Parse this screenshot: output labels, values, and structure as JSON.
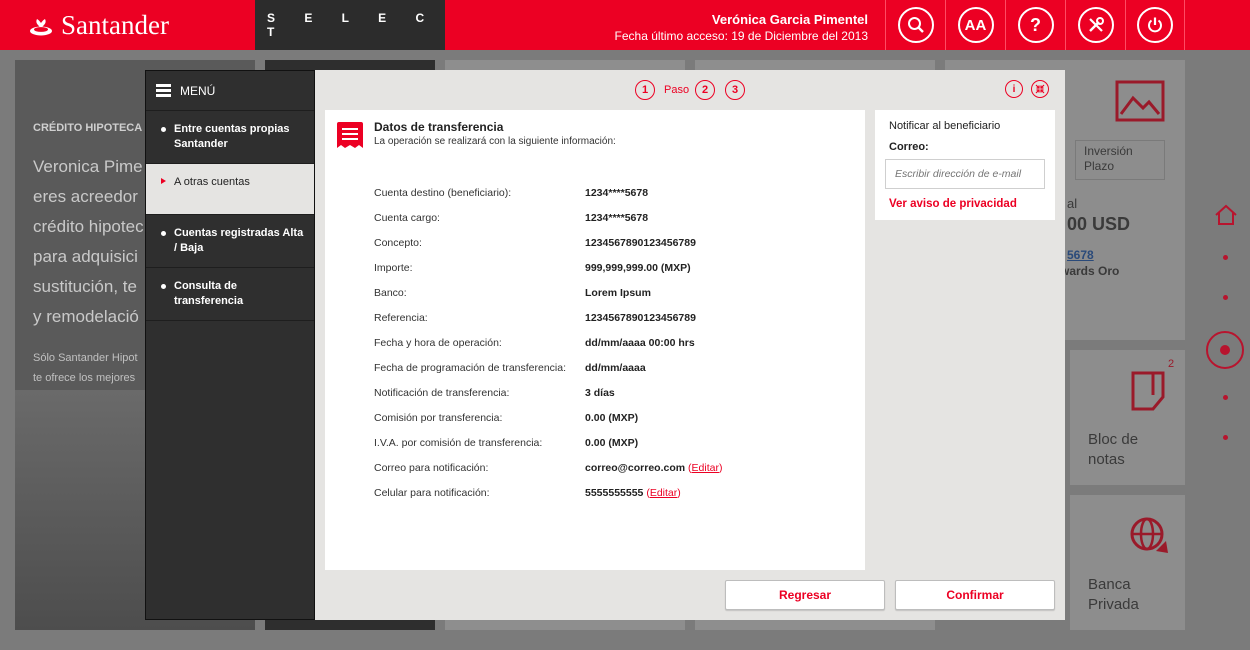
{
  "header": {
    "brand": "Santander",
    "segment": "S E L E C T",
    "user_name": "Verónica Garcia Pimentel",
    "last_access": "Fecha último acceso: 19 de Diciembre del 2013",
    "font_size_label": "AA",
    "help_label": "?"
  },
  "background": {
    "hero_kicker": "CRÉDITO HIPOTECA",
    "hero_lines": [
      "Veronica Pime",
      "eres acreedor",
      "crédito hipotec",
      "para adquisici",
      "sustitución, te",
      "y remodelació"
    ],
    "hero_small": [
      "Sólo Santander Hipot",
      "te ofrece los mejores"
    ],
    "inv_label": "Inversión Plazo",
    "amount_fragment": "00 USD",
    "account_fragment": "5678",
    "card_fragment": "wards Oro",
    "al_fragment": "al",
    "notes_badge": "2",
    "notes_label": "Bloc de notas",
    "bank_label": "Banca Privada"
  },
  "menu": {
    "title": "MENÚ",
    "items": [
      {
        "label": "Entre cuentas propias Santander"
      },
      {
        "label": "A otras cuentas"
      },
      {
        "label": "Cuentas registradas Alta / Baja"
      },
      {
        "label": "Consulta de transferencia"
      }
    ]
  },
  "steps": {
    "labels": [
      "1",
      "2",
      "3"
    ],
    "word": "Paso",
    "info": "i"
  },
  "transfer": {
    "title": "Datos de transferencia",
    "subtitle": "La operación se realizará con la siguiente información:",
    "rows": [
      {
        "k": "Cuenta destino (beneficiario):",
        "v": "1234****5678"
      },
      {
        "k": "Cuenta cargo:",
        "v": "1234****5678"
      },
      {
        "k": "Concepto:",
        "v": "1234567890123456789"
      },
      {
        "k": "Importe:",
        "v": "999,999,999.00 (MXP)"
      },
      {
        "k": "Banco:",
        "v": "Lorem Ipsum"
      },
      {
        "k": "Referencia:",
        "v": "1234567890123456789"
      },
      {
        "k": "Fecha y hora de operación:",
        "v": "dd/mm/aaaa 00:00 hrs"
      },
      {
        "k": "Fecha de programación de transferencia:",
        "v": "dd/mm/aaaa"
      },
      {
        "k": "Notificación de transferencia:",
        "v": "3 días"
      },
      {
        "k": "Comisión por transferencia:",
        "v": "0.00 (MXP)"
      },
      {
        "k": "I.V.A. por comisión de transferencia:",
        "v": "0.00 (MXP)"
      },
      {
        "k": "Correo para notificación:",
        "v": "correo@correo.com",
        "edit": "Editar"
      },
      {
        "k": "Celular para notificación:",
        "v": "5555555555",
        "edit": "Editar"
      }
    ]
  },
  "notify": {
    "heading": "Notificar al beneficiario",
    "email_label": "Correo:",
    "email_placeholder": "Escribir dirección de e-mail",
    "email_value": "",
    "privacy": "Ver aviso de privacidad"
  },
  "actions": {
    "back": "Regresar",
    "confirm": "Confirmar"
  },
  "colors": {
    "brand_red": "#ec0023",
    "dark": "#2f2f2f",
    "modal_bg": "#e5e4e2"
  }
}
